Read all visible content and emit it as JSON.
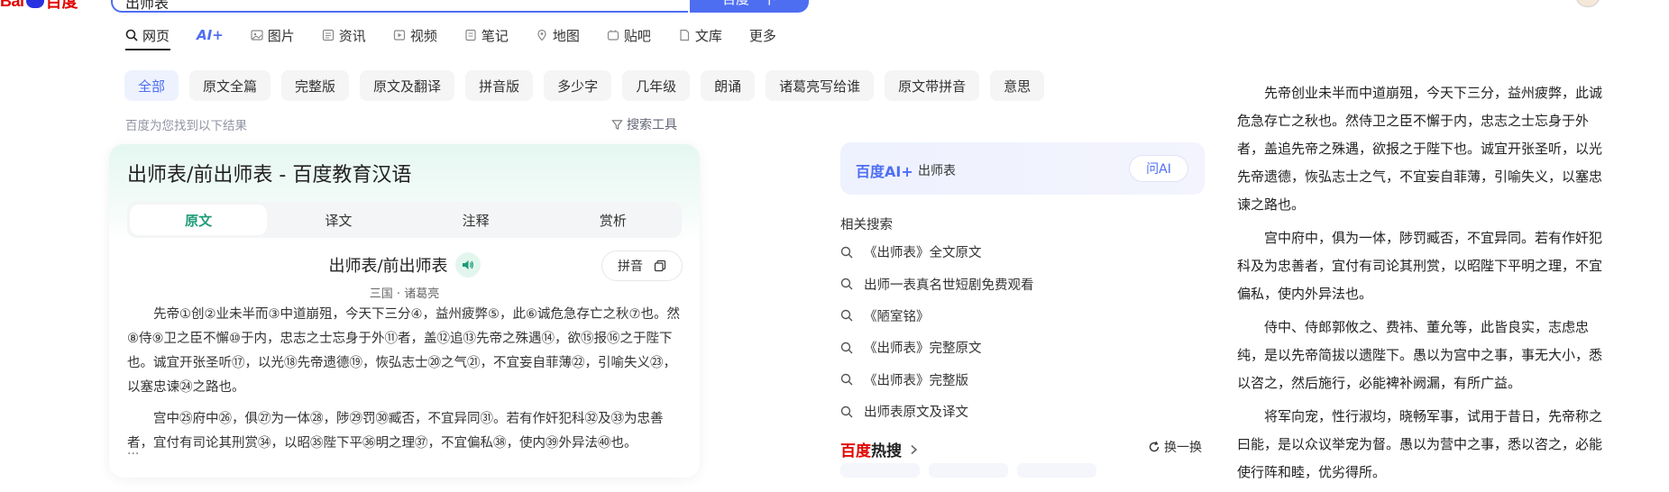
{
  "header": {
    "logo_part1": "Bai",
    "logo_part2": "百度",
    "query": "出师表",
    "search_button": "百度一下"
  },
  "nav": {
    "tabs": [
      "网页",
      "AI+",
      "图片",
      "资讯",
      "视频",
      "笔记",
      "地图",
      "贴吧",
      "文库",
      "更多"
    ]
  },
  "chips": [
    "全部",
    "原文全篇",
    "完整版",
    "原文及翻译",
    "拼音版",
    "多少字",
    "几年级",
    "朗诵",
    "诸葛亮写给谁",
    "原文带拼音",
    "意思"
  ],
  "results": {
    "found_text": "百度为您找到以下结果",
    "tools": "搜索工具"
  },
  "card": {
    "title": "出师表/前出师表 - 百度教育汉语",
    "tabs": [
      "原文",
      "译文",
      "注释",
      "赏析"
    ],
    "poem_title": "出师表/前出师表",
    "pinyin": "拼音",
    "author": "三国 · 诸葛亮",
    "para1": "先帝①创②业未半而③中道崩殂，今天下三分④，益州疲弊⑤，此⑥诚危急存亡之秋⑦也。然⑧侍⑨卫之臣不懈⑩于内，忠志之士忘身于外⑪者，盖⑫追⑬先帝之殊遇⑭，欲⑮报⑯之于陛下也。诚宜开张圣听⑰，以光⑱先帝遗德⑲，恢弘志士⑳之气㉑，不宜妄自菲薄㉒，引喻失义㉓，以塞忠谏㉔之路也。",
    "para2": "宫中㉕府中㉖，俱㉗为一体㉘，陟㉙罚㉚臧否，不宜异同㉛。若有作奸犯科㉜及㉝为忠善者，宜付有司论其刑赏㉞，以昭㉟陛下平㊱明之理㊲，不宜偏私㊳，使内㊴外异法㊵也。",
    "ellipsis": "..."
  },
  "ai": {
    "brand": "百度AI+",
    "query": "出师表",
    "ask": "问AI"
  },
  "related": {
    "title": "相关搜索",
    "items": [
      "《出师表》全文原文",
      "出师一表真名世短剧免费观看",
      "《陋室铭》",
      "《出师表》完整原文",
      "《出师表》完整版",
      "出师表原文及译文"
    ]
  },
  "hot": {
    "title_a": "百度",
    "title_b": "热搜",
    "refresh": "换一换"
  },
  "fulltext": {
    "paras": [
      "先帝创业未半而中道崩殂，今天下三分，益州疲弊，此诚危急存亡之秋也。然侍卫之臣不懈于内，忠志之士忘身于外者，盖追先帝之殊遇，欲报之于陛下也。诚宜开张圣听，以光先帝遗德，恢弘志士之气，不宜妄自菲薄，引喻失义，以塞忠谏之路也。",
      "宫中府中，俱为一体，陟罚臧否，不宜异同。若有作奸犯科及为忠善者，宜付有司论其刑赏，以昭陛下平明之理，不宜偏私，使内外异法也。",
      "侍中、侍郎郭攸之、费祎、董允等，此皆良实，志虑忠纯，是以先帝简拔以遗陛下。愚以为宫中之事，事无大小，悉以咨之，然后施行，必能裨补阙漏，有所广益。",
      "将军向宠，性行淑均，晓畅军事，试用于昔日，先帝称之曰能，是以众议举宠为督。愚以为营中之事，悉以咨之，必能使行阵和睦，优劣得所。"
    ]
  }
}
